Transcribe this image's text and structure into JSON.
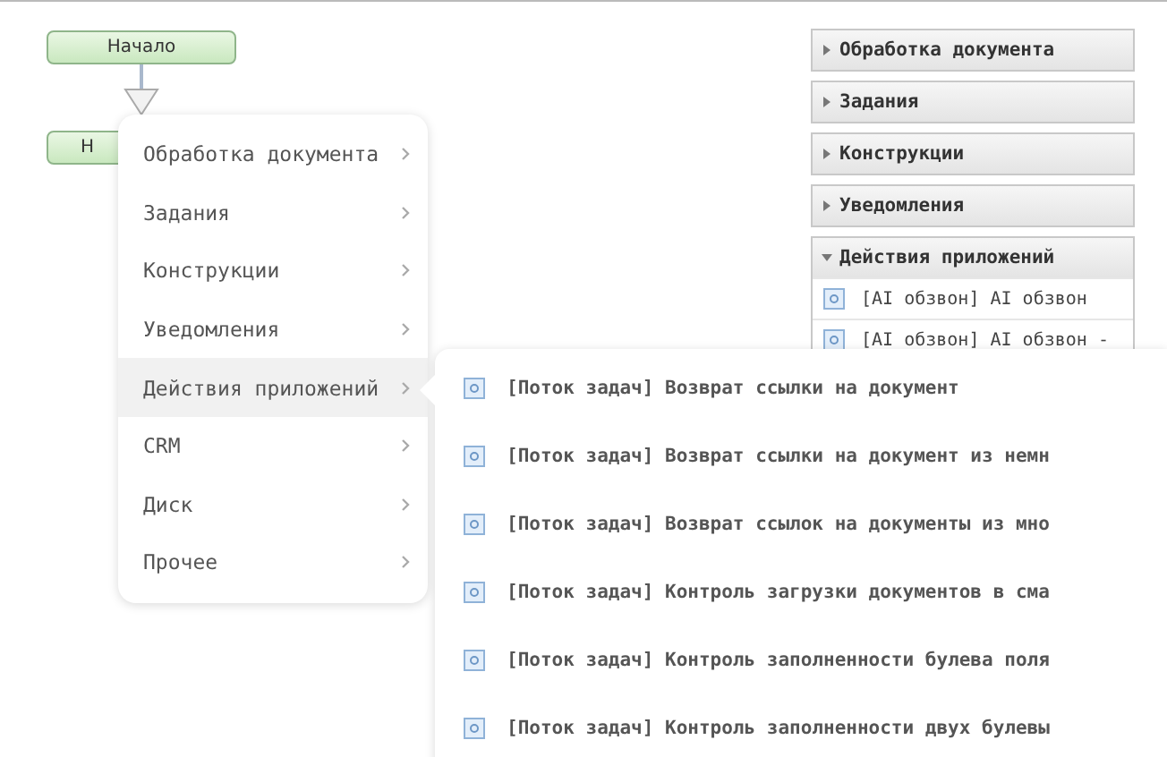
{
  "nodes": [
    {
      "label": "Начало"
    },
    {
      "label": "Н"
    }
  ],
  "palette": [
    {
      "label": "Обработка документа",
      "expanded": false
    },
    {
      "label": "Задания",
      "expanded": false
    },
    {
      "label": "Конструкции",
      "expanded": false
    },
    {
      "label": "Уведомления",
      "expanded": false
    },
    {
      "label": "Действия приложений",
      "expanded": true,
      "items": [
        "[AI обзвон] AI обзвон",
        "[AI обзвон] AI обзвон -"
      ]
    }
  ],
  "menu": [
    {
      "label": "Обработка документа",
      "selected": false
    },
    {
      "label": "Задания",
      "selected": false
    },
    {
      "label": "Конструкции",
      "selected": false
    },
    {
      "label": "Уведомления",
      "selected": false
    },
    {
      "label": "Действия приложений",
      "selected": true
    },
    {
      "label": "CRM",
      "selected": false
    },
    {
      "label": "Диск",
      "selected": false
    },
    {
      "label": "Прочее",
      "selected": false
    }
  ],
  "submenu": [
    "[Поток задач] Возврат ссылки на документ",
    "[Поток задач] Возврат ссылки на документ из немн",
    "[Поток задач] Возврат ссылок на документы из мно",
    "[Поток задач] Контроль загрузки документов в сма",
    "[Поток задач] Контроль заполненности булева поля",
    "[Поток задач] Контроль заполненности двух булевы"
  ]
}
